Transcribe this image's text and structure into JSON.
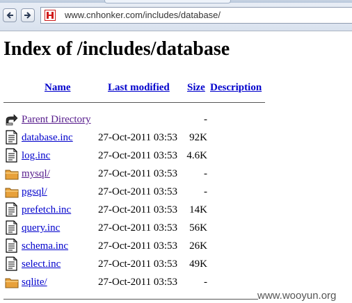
{
  "browser": {
    "url": "www.cnhonker.com/includes/database/",
    "back_icon": "back-arrow-icon",
    "forward_icon": "forward-arrow-icon",
    "favicon": "cnhonker-favicon-icon"
  },
  "page": {
    "title": "Index of /includes/database",
    "columns": {
      "name": "Name",
      "last_modified": "Last modified",
      "size": "Size",
      "description": "Description"
    },
    "entries": [
      {
        "name": "Parent Directory",
        "date": "",
        "size": "-",
        "icon": "back-folder-icon",
        "visited": true
      },
      {
        "name": "database.inc",
        "date": "27-Oct-2011 03:53",
        "size": "92K",
        "icon": "text-file-icon",
        "visited": false
      },
      {
        "name": "log.inc",
        "date": "27-Oct-2011 03:53",
        "size": "4.6K",
        "icon": "text-file-icon",
        "visited": false
      },
      {
        "name": "mysql/",
        "date": "27-Oct-2011 03:53",
        "size": "-",
        "icon": "folder-icon",
        "visited": true
      },
      {
        "name": "pgsql/",
        "date": "27-Oct-2011 03:53",
        "size": "-",
        "icon": "folder-icon",
        "visited": false
      },
      {
        "name": "prefetch.inc",
        "date": "27-Oct-2011 03:53",
        "size": "14K",
        "icon": "text-file-icon",
        "visited": false
      },
      {
        "name": "query.inc",
        "date": "27-Oct-2011 03:53",
        "size": "56K",
        "icon": "text-file-icon",
        "visited": false
      },
      {
        "name": "schema.inc",
        "date": "27-Oct-2011 03:53",
        "size": "26K",
        "icon": "text-file-icon",
        "visited": false
      },
      {
        "name": "select.inc",
        "date": "27-Oct-2011 03:53",
        "size": "49K",
        "icon": "text-file-icon",
        "visited": false
      },
      {
        "name": "sqlite/",
        "date": "27-Oct-2011 03:53",
        "size": "-",
        "icon": "folder-icon",
        "visited": false
      }
    ]
  },
  "watermark": "www.wooyun.org",
  "colors": {
    "link": "#0000cc",
    "visited_link": "#551a8b",
    "folder": "#e8a13a"
  }
}
